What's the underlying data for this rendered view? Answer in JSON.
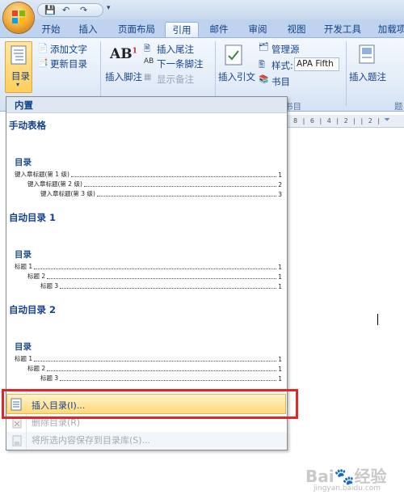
{
  "quick_access": {
    "save": "💾",
    "undo": "↶",
    "redo": "↷",
    "more": "▾"
  },
  "tabs": [
    {
      "label": "开始"
    },
    {
      "label": "插入"
    },
    {
      "label": "页面布局"
    },
    {
      "label": "引用",
      "active": true
    },
    {
      "label": "邮件"
    },
    {
      "label": "审阅"
    },
    {
      "label": "视图"
    },
    {
      "label": "开发工具"
    },
    {
      "label": "加载项"
    }
  ],
  "ribbon": {
    "toc_button": "目录",
    "add_text": "添加文字",
    "update_toc": "更新目录",
    "insert_footnote": "插入脚注",
    "insert_endnote": "插入尾注",
    "next_footnote": "下一条脚注",
    "show_notes": "显示备注",
    "insert_citation": "插入引文",
    "manage_sources": "管理源",
    "style_label": "样式:",
    "style_value": "APA Fifth",
    "bibliography": "书目",
    "insert_caption": "插入题注",
    "group_caption_citation": "书目",
    "group_caption_caption": "题"
  },
  "gallery": {
    "header": "内置",
    "sections": [
      {
        "title": "手动表格",
        "preview_title": "目录",
        "lines": [
          {
            "text": "键入章标题(第 1 级)",
            "page": "1"
          },
          {
            "text": "键入章标题(第 2 级)",
            "page": "2"
          },
          {
            "text": "键入章标题(第 3 级)",
            "page": "3"
          }
        ]
      },
      {
        "title": "自动目录 1",
        "preview_title": "目录",
        "lines": [
          {
            "text": "标题 1",
            "page": "1"
          },
          {
            "text": "标题 2",
            "page": "1"
          },
          {
            "text": "标题 3",
            "page": "1"
          }
        ]
      },
      {
        "title": "自动目录 2",
        "preview_title": "目录",
        "lines": [
          {
            "text": "标题 1",
            "page": "1"
          },
          {
            "text": "标题 2",
            "page": "1"
          },
          {
            "text": "标题 3",
            "page": "1"
          }
        ]
      }
    ],
    "commands": {
      "insert_toc": "插入目录(I)...",
      "delete_toc": "删除目录(R)",
      "save_selection": "将所选内容保存到目录库(S)..."
    }
  },
  "ruler": {
    "text": "8 | 6 | 4 | 2 | | 2 |"
  },
  "watermark": {
    "main": "Bai🐾经验",
    "sub": "jingyan.baidu.com"
  },
  "colors": {
    "accent": "#15428b",
    "highlight": "#e0262b",
    "hover": "#ffd97b"
  }
}
